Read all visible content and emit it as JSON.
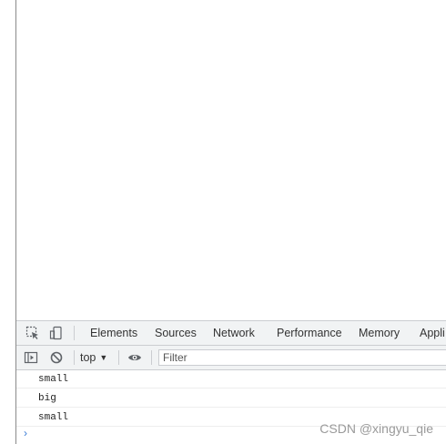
{
  "devtools": {
    "tabs": [
      "Elements",
      "Sources",
      "Network",
      "Performance",
      "Memory",
      "Appli"
    ],
    "context": "top",
    "filter_placeholder": "Filter"
  },
  "console": {
    "messages": [
      "small",
      "big",
      "small"
    ],
    "prompt_glyph": "›"
  },
  "watermark": "CSDN @xingyu_qie",
  "icons": [
    "inspect-element-icon",
    "device-toolbar-icon",
    "sidebar-toggle-icon",
    "clear-console-icon",
    "dropdown-arrow-icon",
    "eye-icon"
  ],
  "colors": {
    "toolbar_bg": "#f1f3f4",
    "border": "#cbcdd1",
    "prompt": "#3a7bd5"
  }
}
